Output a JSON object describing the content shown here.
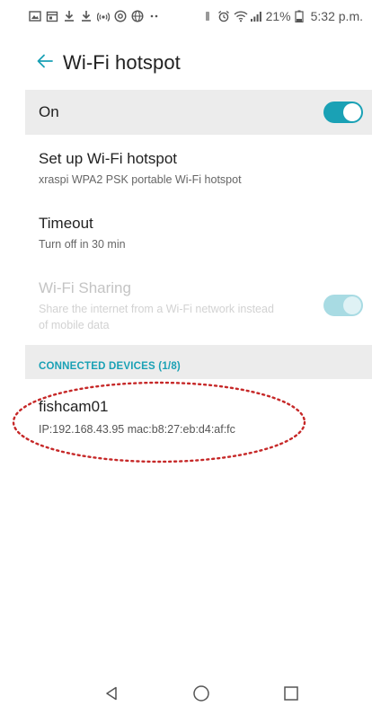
{
  "status_bar": {
    "battery": "21%",
    "time": "5:32 p.m."
  },
  "header": {
    "title": "Wi-Fi hotspot",
    "back_icon": "arrow-left-icon"
  },
  "master_switch": {
    "label": "On",
    "state": "on"
  },
  "settings": [
    {
      "title": "Set up Wi-Fi hotspot",
      "subtitle": "xraspi WPA2 PSK portable Wi-Fi hotspot",
      "enabled": true
    },
    {
      "title": "Timeout",
      "subtitle": "Turn off in 30 min",
      "enabled": true
    },
    {
      "title": "Wi-Fi Sharing",
      "subtitle": "Share the internet from a Wi-Fi network instead of mobile data",
      "enabled": false,
      "toggle_state": "on"
    }
  ],
  "connected_devices": {
    "header": "CONNECTED DEVICES (1/8)",
    "items": [
      {
        "name": "fishcam01",
        "detail": "IP:192.168.43.95  mac:b8:27:eb:d4:af:fc"
      }
    ]
  },
  "annotation": {
    "color": "#c62828"
  },
  "colors": {
    "accent": "#1aa1b5",
    "section_background": "#ececec"
  },
  "nav_bar": {
    "back_icon": "triangle-back-icon",
    "home_icon": "circle-home-icon",
    "recents_icon": "square-recents-icon"
  }
}
